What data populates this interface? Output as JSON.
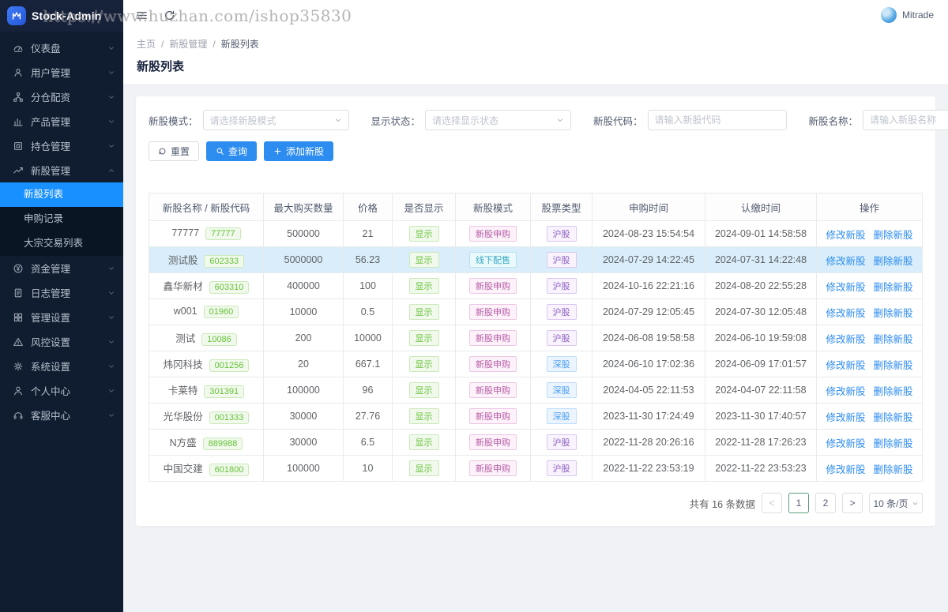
{
  "watermark": "https://www.huzhan.com/ishop35830",
  "colors": {
    "accent_blue": "#2d8cf0",
    "menu_active_blue": "#1890ff",
    "success_green": "#67c23a",
    "tag_magenta": "#b65ba5",
    "tag_cyan": "#35a9c4",
    "tag_purple": "#8f5fc3",
    "tag_blue": "#4a9ef5",
    "highlight_row": "#d9eefa",
    "sidebar_bg": "#101d30",
    "pagination_active_border": "#5d9e7d"
  },
  "sidebar": {
    "logo_text": "Stock-Admin",
    "items": [
      {
        "label": "仪表盘",
        "icon": "gauge-icon"
      },
      {
        "label": "用户管理",
        "icon": "users-icon"
      },
      {
        "label": "分仓配资",
        "icon": "share-icon"
      },
      {
        "label": "产品管理",
        "icon": "chart-icon"
      },
      {
        "label": "持仓管理",
        "icon": "holdings-icon"
      },
      {
        "label": "新股管理",
        "icon": "trend-icon",
        "expanded": true,
        "children": [
          {
            "label": "新股列表",
            "active": true
          },
          {
            "label": "申购记录",
            "active": false
          },
          {
            "label": "大宗交易列表",
            "active": false
          }
        ]
      },
      {
        "label": "资金管理",
        "icon": "money-icon"
      },
      {
        "label": "日志管理",
        "icon": "log-icon"
      },
      {
        "label": "管理设置",
        "icon": "grid-icon"
      },
      {
        "label": "风控设置",
        "icon": "risk-icon"
      },
      {
        "label": "系统设置",
        "icon": "gear-icon"
      },
      {
        "label": "个人中心",
        "icon": "person-icon"
      },
      {
        "label": "客服中心",
        "icon": "headset-icon"
      }
    ]
  },
  "topbar": {
    "user_name": "Mitrade"
  },
  "breadcrumb": {
    "items": [
      "主页",
      "新股管理",
      "新股列表"
    ],
    "separator": "/"
  },
  "page_title": "新股列表",
  "filters": [
    {
      "label": "新股模式：",
      "type": "select",
      "placeholder": "请选择新股模式"
    },
    {
      "label": "显示状态：",
      "type": "select",
      "placeholder": "请选择显示状态"
    },
    {
      "label": "新股代码：",
      "type": "input",
      "placeholder": "请输入新股代码"
    },
    {
      "label": "新股名称：",
      "type": "input",
      "placeholder": "请输入新股名称"
    }
  ],
  "buttons": {
    "reset": "重置",
    "search": "查询",
    "add": "添加新股"
  },
  "table": {
    "columns": [
      "新股名称 / 新股代码",
      "最大购买数量",
      "价格",
      "是否显示",
      "新股模式",
      "股票类型",
      "申购时间",
      "认缴时间",
      "操作"
    ],
    "actions": {
      "edit": "修改新股",
      "delete": "删除新股"
    },
    "rows": [
      {
        "name": "77777",
        "code": "77777",
        "max": "500000",
        "price": "21",
        "display": "显示",
        "mode": {
          "label": "新股申购",
          "color": "magenta"
        },
        "type": {
          "label": "沪股",
          "color": "purple"
        },
        "apply_time": "2024-08-23 15:54:54",
        "pay_time": "2024-09-01 14:58:58",
        "highlighted": false
      },
      {
        "name": "测试股",
        "code": "602333",
        "max": "5000000",
        "price": "56.23",
        "display": "显示",
        "mode": {
          "label": "线下配售",
          "color": "cyan"
        },
        "type": {
          "label": "沪股",
          "color": "purple"
        },
        "apply_time": "2024-07-29 14:22:45",
        "pay_time": "2024-07-31 14:22:48",
        "highlighted": true
      },
      {
        "name": "鑫华新材",
        "code": "603310",
        "max": "400000",
        "price": "100",
        "display": "显示",
        "mode": {
          "label": "新股申购",
          "color": "magenta"
        },
        "type": {
          "label": "沪股",
          "color": "purple"
        },
        "apply_time": "2024-10-16 22:21:16",
        "pay_time": "2024-08-20 22:55:28",
        "highlighted": false
      },
      {
        "name": "w001",
        "code": "01960",
        "max": "10000",
        "price": "0.5",
        "display": "显示",
        "mode": {
          "label": "新股申购",
          "color": "magenta"
        },
        "type": {
          "label": "沪股",
          "color": "purple"
        },
        "apply_time": "2024-07-29 12:05:45",
        "pay_time": "2024-07-30 12:05:48",
        "highlighted": false
      },
      {
        "name": "测试",
        "code": "10086",
        "max": "200",
        "price": "10000",
        "display": "显示",
        "mode": {
          "label": "新股申购",
          "color": "magenta"
        },
        "type": {
          "label": "沪股",
          "color": "purple"
        },
        "apply_time": "2024-06-08 19:58:58",
        "pay_time": "2024-06-10 19:59:08",
        "highlighted": false
      },
      {
        "name": "炜冈科技",
        "code": "001256",
        "max": "20",
        "price": "667.1",
        "display": "显示",
        "mode": {
          "label": "新股申购",
          "color": "magenta"
        },
        "type": {
          "label": "深股",
          "color": "blue"
        },
        "apply_time": "2024-06-10 17:02:36",
        "pay_time": "2024-06-09 17:01:57",
        "highlighted": false
      },
      {
        "name": "卡莱特",
        "code": "301391",
        "max": "100000",
        "price": "96",
        "display": "显示",
        "mode": {
          "label": "新股申购",
          "color": "magenta"
        },
        "type": {
          "label": "深股",
          "color": "blue"
        },
        "apply_time": "2024-04-05 22:11:53",
        "pay_time": "2024-04-07 22:11:58",
        "highlighted": false
      },
      {
        "name": "光华股份",
        "code": "001333",
        "max": "30000",
        "price": "27.76",
        "display": "显示",
        "mode": {
          "label": "新股申购",
          "color": "magenta"
        },
        "type": {
          "label": "深股",
          "color": "blue"
        },
        "apply_time": "2023-11-30 17:24:49",
        "pay_time": "2023-11-30 17:40:57",
        "highlighted": false
      },
      {
        "name": "N方盛",
        "code": "889988",
        "max": "30000",
        "price": "6.5",
        "display": "显示",
        "mode": {
          "label": "新股申购",
          "color": "magenta"
        },
        "type": {
          "label": "沪股",
          "color": "purple"
        },
        "apply_time": "2022-11-28 20:26:16",
        "pay_time": "2022-11-28 17:26:23",
        "highlighted": false
      },
      {
        "name": "中国交建",
        "code": "601800",
        "max": "100000",
        "price": "10",
        "display": "显示",
        "mode": {
          "label": "新股申购",
          "color": "magenta"
        },
        "type": {
          "label": "沪股",
          "color": "purple"
        },
        "apply_time": "2022-11-22 23:53:19",
        "pay_time": "2022-11-22 23:53:23",
        "highlighted": false
      }
    ]
  },
  "pagination": {
    "total_text": "共有 16 条数据",
    "prev": "<",
    "pages": [
      "1",
      "2"
    ],
    "active_page": "1",
    "next": ">",
    "page_size": "10 条/页"
  }
}
